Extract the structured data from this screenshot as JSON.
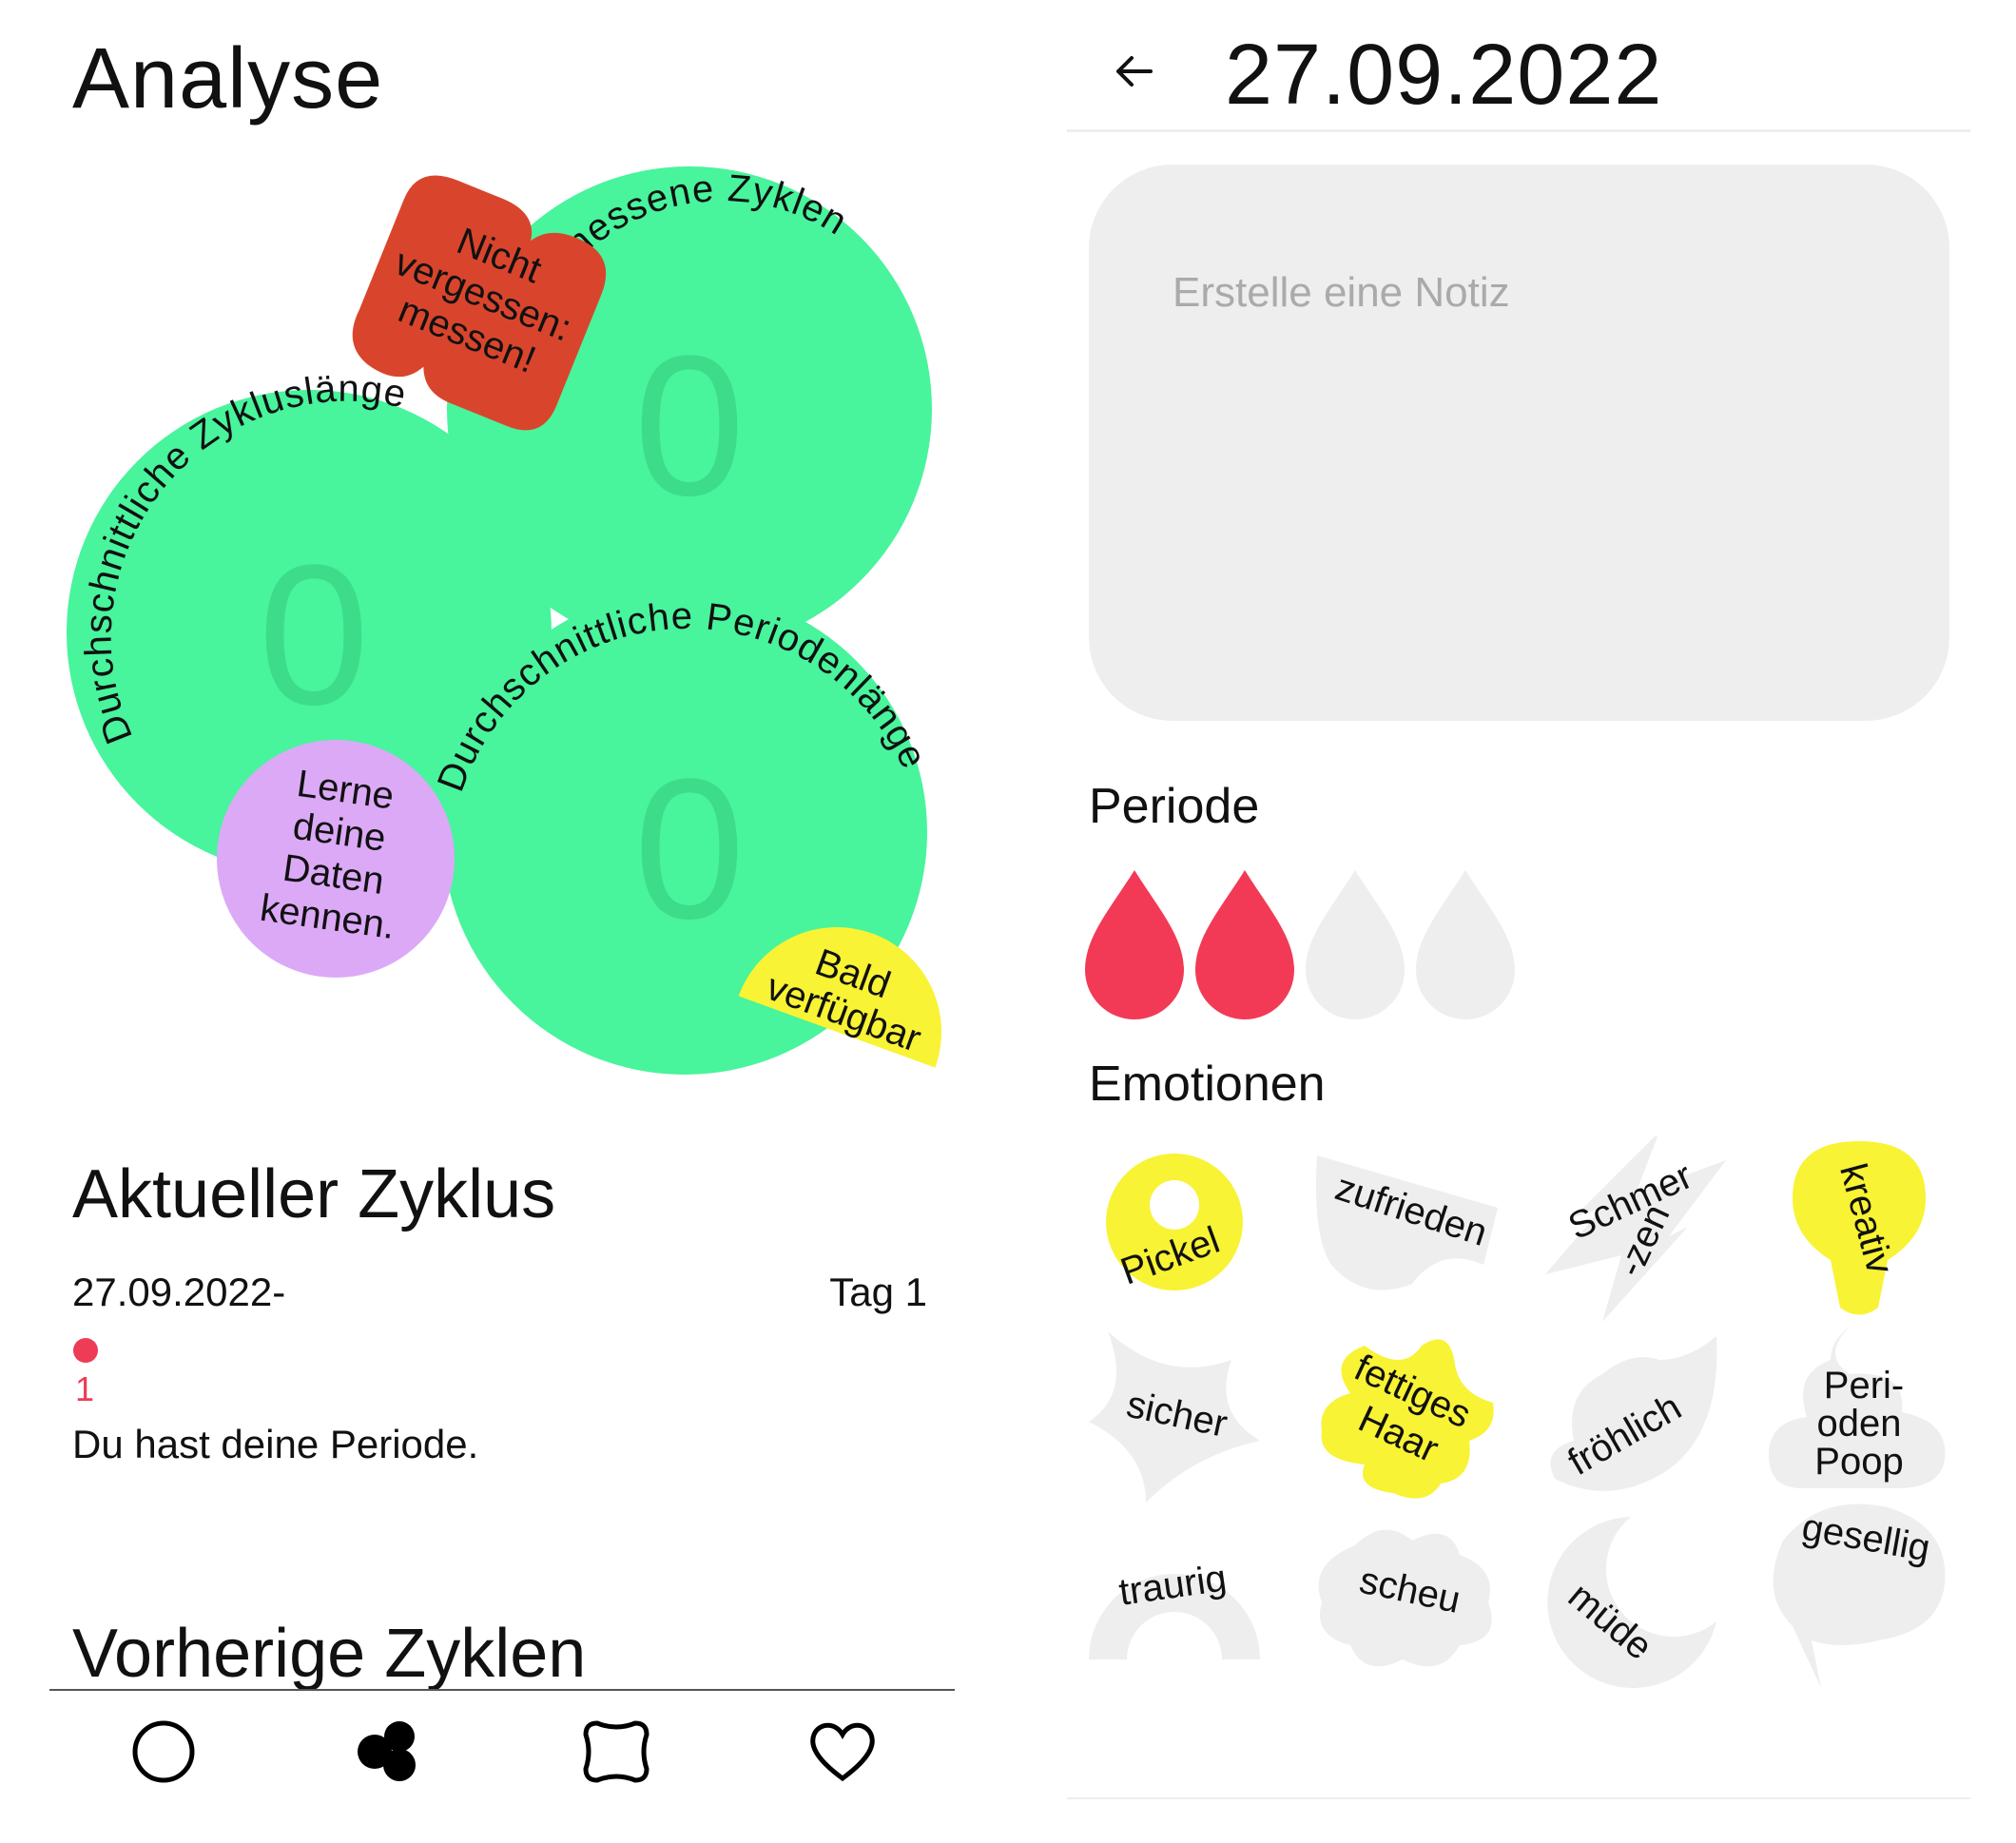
{
  "analyse": {
    "title": "Analyse",
    "stats": [
      {
        "label": "Gemessene Zyklen",
        "value": "0"
      },
      {
        "label": "Durchschnittliche Zykluslänge",
        "value": "0"
      },
      {
        "label": "Durchschnittliche Periodenlänge",
        "value": "0"
      }
    ],
    "stickers": {
      "reminder": [
        "Nicht",
        "vergessen:",
        "messen!"
      ],
      "learn": [
        "Lerne",
        "deine",
        "Daten",
        "kennen."
      ],
      "soon": [
        "Bald",
        "verfügbar"
      ]
    },
    "current_cycle": {
      "title": "Aktueller Zyklus",
      "date_range": "27.09.2022-",
      "day_label": "Tag 1",
      "period_day": "1",
      "message": "Du hast deine Periode."
    },
    "previous_cycles_title": "Vorherige Zyklen"
  },
  "nav": {
    "items": [
      {
        "icon": "circle-icon",
        "active": false
      },
      {
        "icon": "blob-cluster-icon",
        "active": true
      },
      {
        "icon": "rounded-square-icon",
        "active": false
      },
      {
        "icon": "heart-icon",
        "active": false
      }
    ]
  },
  "detail": {
    "date": "27.09.2022",
    "note_placeholder": "Erstelle eine Notiz",
    "period": {
      "title": "Periode",
      "level": 2,
      "max": 4,
      "active_color": "#f23a56",
      "inactive_color": "#eeeeee"
    },
    "emotions": {
      "title": "Emotionen",
      "items": [
        {
          "label": "Pickel",
          "selected": true
        },
        {
          "label": "zufrieden",
          "selected": false
        },
        {
          "label": "Schmer\n-zen",
          "selected": false
        },
        {
          "label": "kreativ",
          "selected": true
        },
        {
          "label": "sicher",
          "selected": false
        },
        {
          "label": "fettiges\nHaar",
          "selected": true
        },
        {
          "label": "fröhlich",
          "selected": false
        },
        {
          "label": "Peri-\noden\nPoop",
          "selected": false
        },
        {
          "label": "traurig",
          "selected": false
        },
        {
          "label": "scheu",
          "selected": false
        },
        {
          "label": "müde",
          "selected": false
        },
        {
          "label": "gesellig",
          "selected": false
        }
      ]
    }
  },
  "colors": {
    "green": "#48f49c",
    "red_sticker": "#d9452c",
    "purple": "#dca9f7",
    "yellow": "#f8f334",
    "period_red": "#f23a56",
    "grey": "#eeeeee"
  }
}
